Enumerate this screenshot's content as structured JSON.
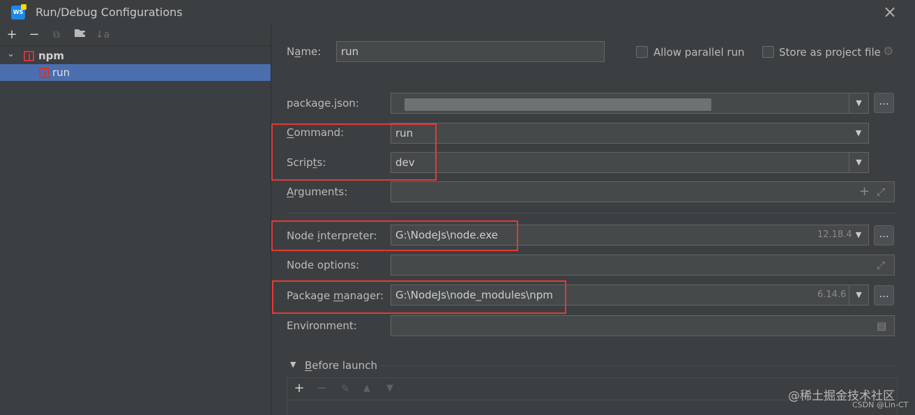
{
  "window": {
    "title": "Run/Debug Configurations",
    "logo_text": "WS"
  },
  "tree_toolbar": {
    "add": "+",
    "remove": "−",
    "copy": "⧉",
    "new_folder": "▰",
    "sort": "↓a"
  },
  "tree": {
    "group": {
      "label": "npm",
      "expanded": true
    },
    "items": [
      {
        "label": "run",
        "selected": true
      }
    ]
  },
  "form": {
    "name_label": "Name:",
    "name_value": "run",
    "allow_parallel_label": "Allow parallel run",
    "allow_parallel_checked": false,
    "store_as_project_label": "Store as project file",
    "store_as_project_checked": false,
    "package_json_label": "package.json:",
    "command_label": "Command:",
    "command_value": "run",
    "scripts_label": "Scripts:",
    "scripts_value": "dev",
    "arguments_label": "Arguments:",
    "node_interpreter_label": "Node interpreter:",
    "node_interpreter_value": "G:\\NodeJs\\node.exe",
    "node_version": "12.18.4",
    "node_options_label": "Node options:",
    "package_manager_label": "Package manager:",
    "package_manager_value": "G:\\NodeJs\\node_modules\\npm",
    "package_manager_version": "6.14.6",
    "environment_label": "Environment:",
    "browse": "...",
    "before_launch_label": "Before launch"
  },
  "watermark": {
    "line1": "@稀土掘金技术社区",
    "line2": "CSDN @Lin-CT"
  },
  "colors": {
    "highlight_box": "#e53935",
    "selection": "#4b6eaf",
    "background": "#3c3f41"
  }
}
